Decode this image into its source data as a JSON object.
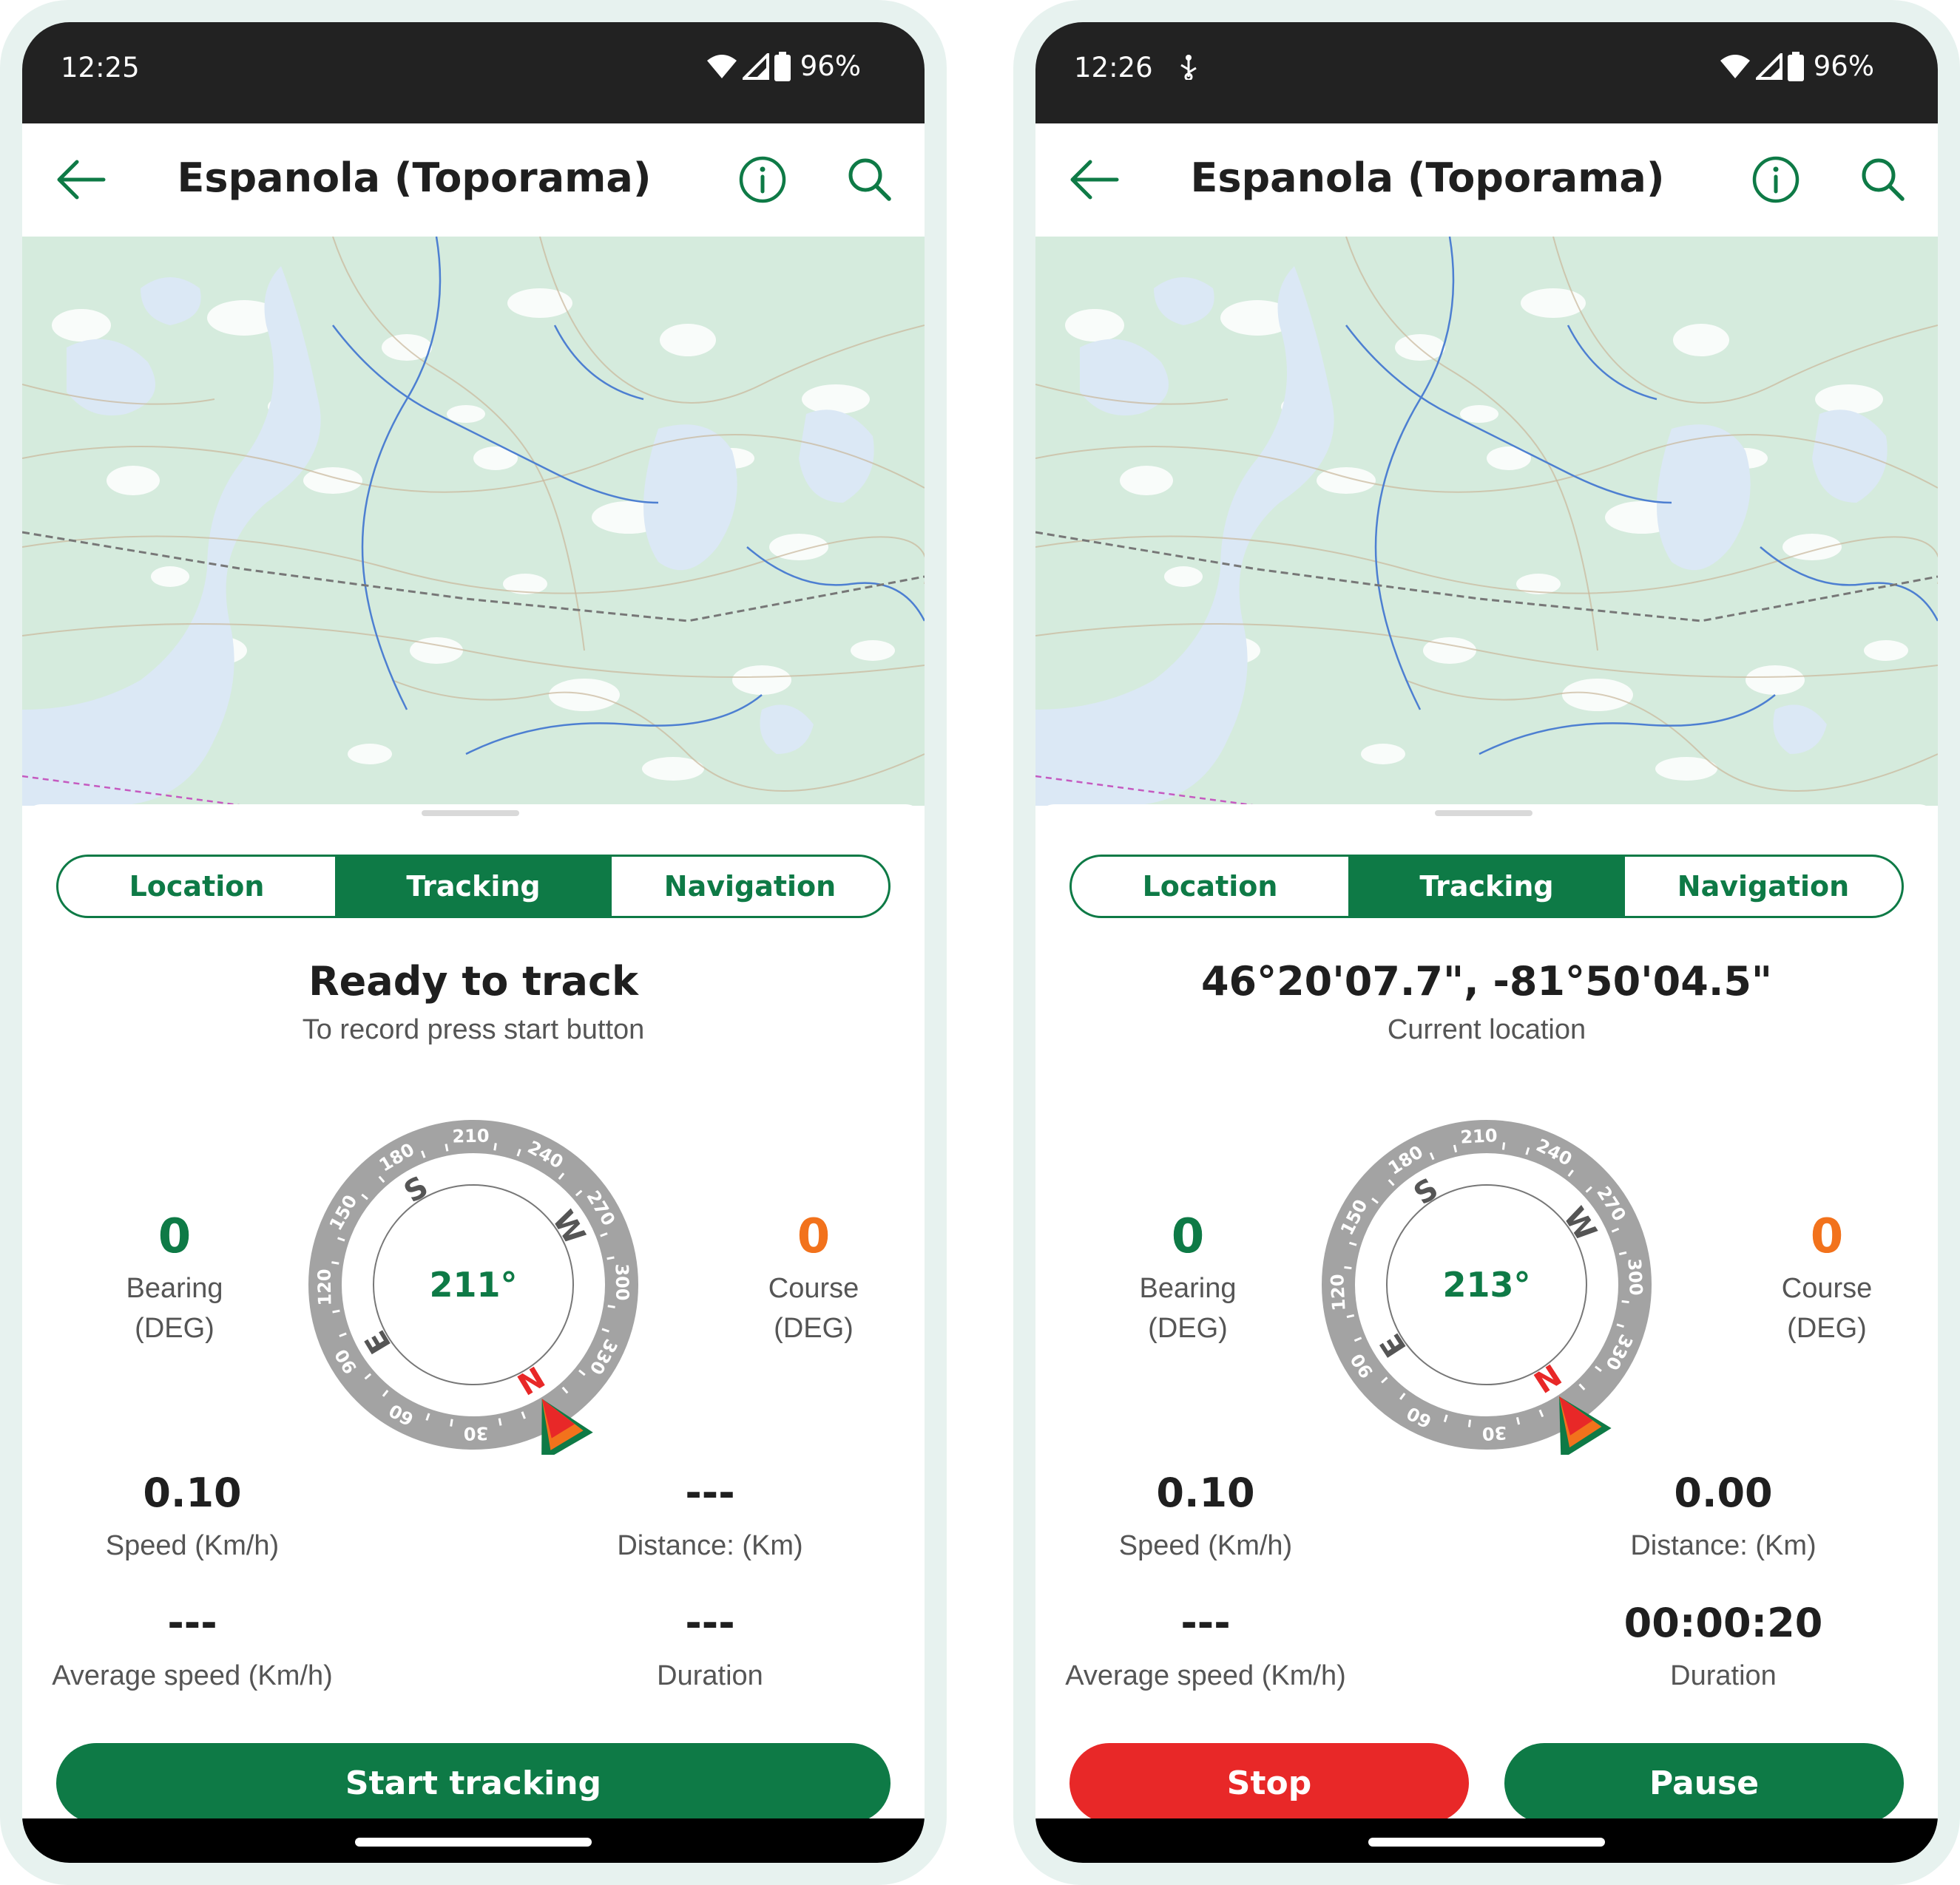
{
  "colors": {
    "brand_green": "#0e7a46",
    "bearing_green": "#0e7a46",
    "course_orange": "#f2721c",
    "stop_red": "#e82828",
    "status_bar": "#222222",
    "map_land": "#d5ebdd",
    "map_water": "#dbe8f5"
  },
  "icons": {
    "back": "arrow-left-icon",
    "info": "info-circle-icon",
    "search": "search-icon",
    "wifi": "wifi-icon",
    "signal": "cell-signal-icon",
    "battery": "battery-icon",
    "usb": "usb-debug-icon"
  },
  "screens": [
    {
      "status": {
        "time": "12:25",
        "battery": "96%"
      },
      "app_title": "Espanola (Toporama)",
      "tabs": [
        {
          "label": "Location",
          "active": false
        },
        {
          "label": "Tracking",
          "active": true
        },
        {
          "label": "Navigation",
          "active": false
        }
      ],
      "headline": "Ready to track",
      "subline": "To record press start button",
      "bearing": {
        "value": "0",
        "label1": "Bearing",
        "label2": "(DEG)"
      },
      "course": {
        "value": "0",
        "label1": "Course",
        "label2": "(DEG)"
      },
      "compass": {
        "heading": "211°",
        "heading_deg": 211,
        "tick_labels": [
          "30",
          "60",
          "90",
          "120",
          "150",
          "180",
          "210",
          "240",
          "270",
          "300",
          "330"
        ],
        "cardinals": {
          "N": "N",
          "E": "E",
          "S": "S",
          "W": "W"
        }
      },
      "speed": {
        "value": "0.10",
        "label": "Speed (Km/h)"
      },
      "distance": {
        "value": "---",
        "label": "Distance: (Km)"
      },
      "avg_speed": {
        "value": "---",
        "label": "Average speed (Km/h)"
      },
      "duration": {
        "value": "---",
        "label": "Duration"
      },
      "buttons": {
        "start": "Start tracking"
      }
    },
    {
      "status": {
        "time": "12:26",
        "battery": "96%"
      },
      "app_title": "Espanola (Toporama)",
      "tabs": [
        {
          "label": "Location",
          "active": false
        },
        {
          "label": "Tracking",
          "active": true
        },
        {
          "label": "Navigation",
          "active": false
        }
      ],
      "headline": "46°20'07.7\", -81°50'04.5\"",
      "subline": "Current location",
      "bearing": {
        "value": "0",
        "label1": "Bearing",
        "label2": "(DEG)"
      },
      "course": {
        "value": "0",
        "label1": "Course",
        "label2": "(DEG)"
      },
      "compass": {
        "heading": "213°",
        "heading_deg": 213,
        "tick_labels": [
          "30",
          "60",
          "90",
          "120",
          "150",
          "180",
          "210",
          "240",
          "270",
          "300",
          "330"
        ],
        "cardinals": {
          "N": "N",
          "E": "E",
          "S": "S",
          "W": "W"
        }
      },
      "speed": {
        "value": "0.10",
        "label": "Speed (Km/h)"
      },
      "distance": {
        "value": "0.00",
        "label": "Distance: (Km)"
      },
      "avg_speed": {
        "value": "---",
        "label": "Average speed (Km/h)"
      },
      "duration": {
        "value": "00:00:20",
        "label": "Duration"
      },
      "buttons": {
        "stop": "Stop",
        "pause": "Pause"
      }
    }
  ]
}
